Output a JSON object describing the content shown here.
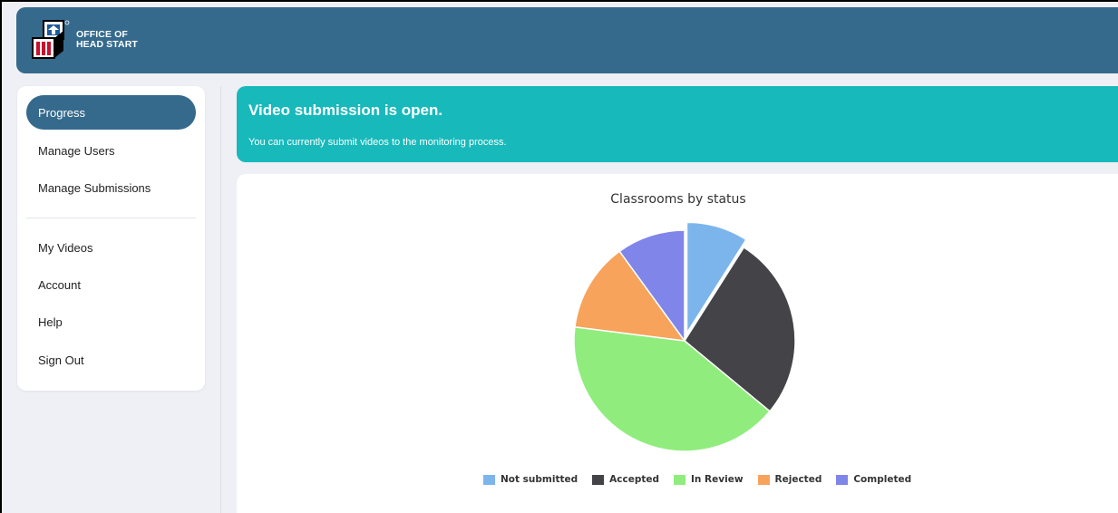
{
  "header": {
    "logo_line1": "OFFICE OF",
    "logo_line2": "HEAD START",
    "logo_icon": "head-start-blocks-logo"
  },
  "sidebar": {
    "items": [
      {
        "label": "Progress",
        "active": true
      },
      {
        "label": "Manage Users"
      },
      {
        "label": "Manage Submissions"
      },
      {
        "label": "My Videos"
      },
      {
        "label": "Account"
      },
      {
        "label": "Help"
      },
      {
        "label": "Sign Out"
      }
    ]
  },
  "banner": {
    "title": "Video submission is open.",
    "message": "You can currently submit videos to the monitoring process."
  },
  "colors": {
    "header": "#356a8d",
    "banner": "#18b9bb",
    "not_submitted": "#7cb5ec",
    "accepted": "#434348",
    "in_review": "#90ed7d",
    "rejected": "#f7a35c",
    "completed": "#8085e9"
  },
  "chart_data": {
    "type": "pie",
    "title": "Classrooms by status",
    "legend_position": "bottom",
    "slices": [
      {
        "name": "Not submitted",
        "value": 9,
        "color": "#7cb5ec",
        "sliced": true
      },
      {
        "name": "Accepted",
        "value": 27,
        "color": "#434348"
      },
      {
        "name": "In Review",
        "value": 41,
        "color": "#90ed7d"
      },
      {
        "name": "Rejected",
        "value": 13,
        "color": "#f7a35c"
      },
      {
        "name": "Completed",
        "value": 10,
        "color": "#8085e9"
      }
    ]
  }
}
